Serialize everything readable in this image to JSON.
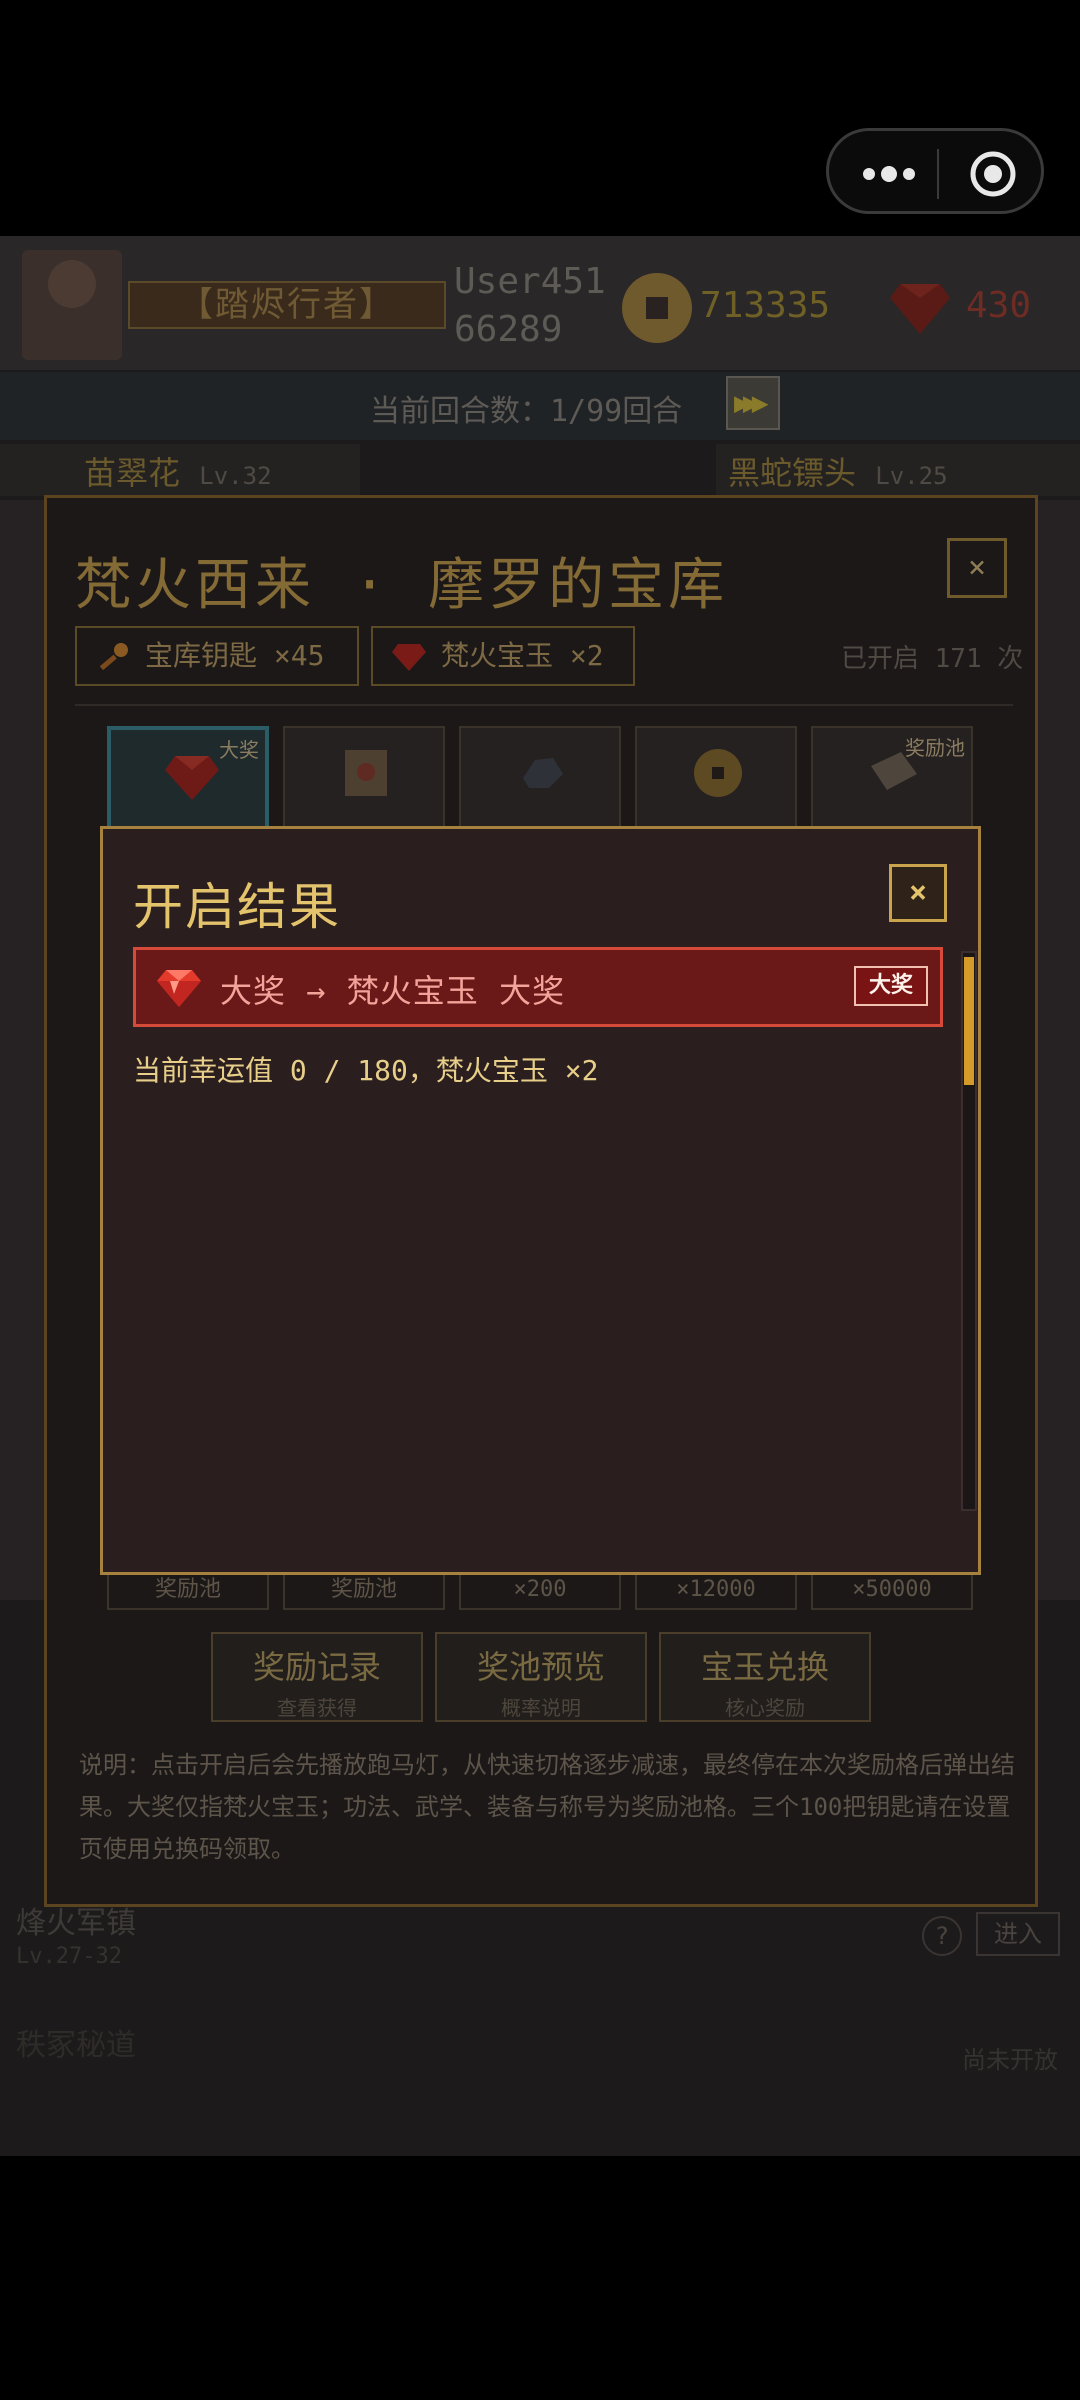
{
  "hud": {
    "player_title": "【踏烬行者】",
    "username": "User451\n66289",
    "coins": "713335",
    "gems": "430",
    "round_text": "当前回合数：1/99回合"
  },
  "heroes": [
    {
      "name": "苗翠花",
      "level": "Lv.32"
    },
    {
      "name": "黑蛇镖头",
      "level": "Lv.25"
    }
  ],
  "background_map": {
    "name": "烽火军镇",
    "level": "Lv.27-32",
    "enter_label": "进入",
    "help_label": "?",
    "next_name": "秩冢秘道",
    "next_status": "尚未开放"
  },
  "panel": {
    "title": "梵火西来 · 摩罗的宝库",
    "close_label": "×",
    "key_chip": "宝库钥匙 ×45",
    "gem_chip": "梵火宝玉 ×2",
    "opened_text": "已开启 171 次",
    "tiles": [
      {
        "tag": "大奖",
        "label": "奖励池"
      },
      {
        "tag": "",
        "label": "奖励池"
      },
      {
        "tag": "",
        "label": "×200"
      },
      {
        "tag": "",
        "label": "×12000"
      },
      {
        "tag": "奖励池",
        "label": "×50000"
      }
    ],
    "buttons": [
      {
        "title": "奖励记录",
        "sub": "查看获得"
      },
      {
        "title": "奖池预览",
        "sub": "概率说明"
      },
      {
        "title": "宝玉兑换",
        "sub": "核心奖励"
      }
    ],
    "notes": "说明：点击开启后会先播放跑马灯，从快速切格逐步减速，最终停在本次奖励格后弹出结果。大奖仅指梵火宝玉；功法、武学、装备与称号为奖励池格。三个100把钥匙请在设置页使用兑换码领取。"
  },
  "modal": {
    "title": "开启结果",
    "close_label": "×",
    "result_text": "大奖 → 梵火宝玉 大奖",
    "result_badge": "大奖",
    "luck_text": "当前幸运值 0 / 180，梵火宝玉 ×2",
    "scroll_fraction": 0.23
  },
  "colors": {
    "modal_border": "#a7823e",
    "title_gold": "#e3c36c",
    "result_bg": "#6a1818",
    "result_border": "#d64a3a",
    "scroll_thumb": "#d49a2a"
  },
  "icons": {
    "capsule": [
      "more-dots-icon",
      "close-target-icon"
    ],
    "result": "red-gem-icon",
    "key": "key-icon"
  }
}
